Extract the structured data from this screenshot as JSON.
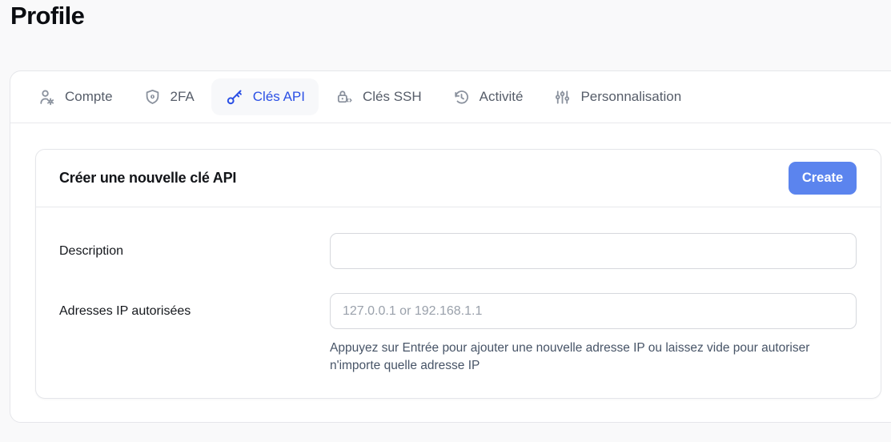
{
  "page": {
    "title": "Profile"
  },
  "colors": {
    "accent_blue": "#2b50e5",
    "button_blue": "#5b84ee",
    "panel_background": "#ffffff",
    "page_background": "#f9f9fa"
  },
  "tabs": [
    {
      "label": "Compte",
      "icon": "user-gear-icon",
      "active": false
    },
    {
      "label": "2FA",
      "icon": "shield-icon",
      "active": false
    },
    {
      "label": "Clés API",
      "icon": "key-icon",
      "active": true
    },
    {
      "label": "Clés SSH",
      "icon": "lock-code-icon",
      "active": false
    },
    {
      "label": "Activité",
      "icon": "history-icon",
      "active": false
    },
    {
      "label": "Personnalisation",
      "icon": "sliders-icon",
      "active": false
    }
  ],
  "api_key_form": {
    "title": "Créer une nouvelle clé API",
    "create_button_label": "Create",
    "fields": [
      {
        "label": "Description",
        "value": "",
        "placeholder": ""
      },
      {
        "label": "Adresses IP autorisées",
        "value": "",
        "placeholder": "127.0.0.1 or 192.168.1.1",
        "help_text": "Appuyez sur Entrée pour ajouter une nouvelle adresse IP ou laissez vide pour autoriser n'importe quelle adresse IP"
      }
    ]
  }
}
